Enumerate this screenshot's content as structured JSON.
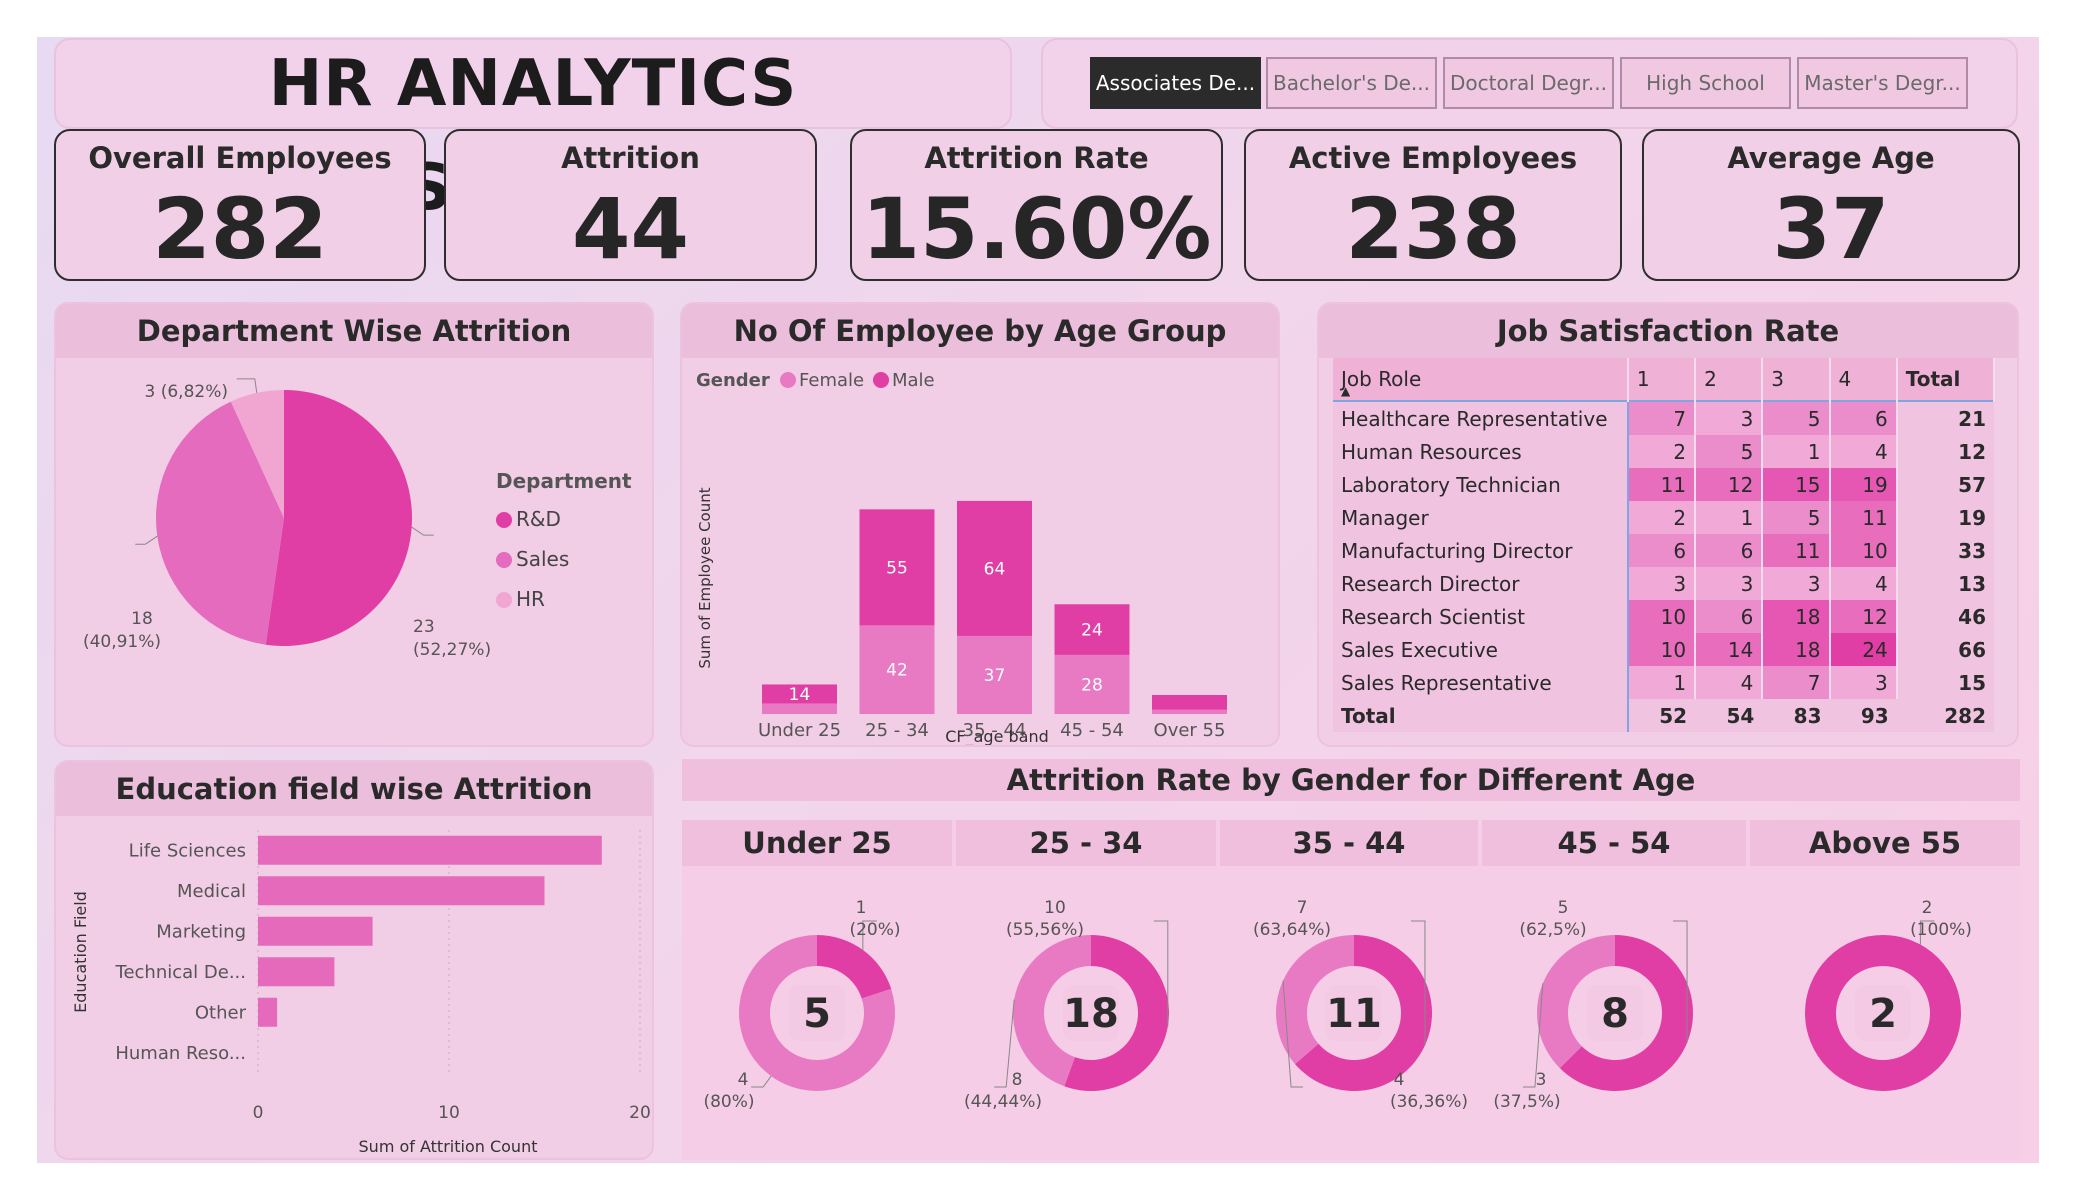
{
  "title": "HR ANALYTICS DASHBOARD",
  "education_slicer": [
    {
      "label": "Associates De...",
      "active": true
    },
    {
      "label": "Bachelor's De...",
      "active": false
    },
    {
      "label": "Doctoral Degr...",
      "active": false
    },
    {
      "label": "High School",
      "active": false
    },
    {
      "label": "Master's Degr...",
      "active": false
    }
  ],
  "kpis": [
    {
      "label": "Overall Employees",
      "value": "282"
    },
    {
      "label": "Attrition",
      "value": "44"
    },
    {
      "label": "Attrition Rate",
      "value": "15.60%"
    },
    {
      "label": "Active Employees",
      "value": "238"
    },
    {
      "label": "Average Age",
      "value": "37"
    }
  ],
  "colors": {
    "rd": "#e03ea4",
    "sales": "#e46bbd",
    "hr": "#f1a6d2",
    "male": "#e03ea4",
    "female": "#e87ac4",
    "bar": "#e66abb"
  },
  "chart_data": [
    {
      "type": "pie",
      "title": "Department Wise Attrition",
      "legend_title": "Department",
      "labels": [
        "R&D",
        "Sales",
        "HR"
      ],
      "values": [
        23,
        18,
        3
      ],
      "data_labels": [
        "23\n(52,27%)",
        "18\n(40,91%)",
        "3 (6,82%)"
      ],
      "legend_position": "right"
    },
    {
      "type": "bar",
      "stacked": true,
      "title": "No Of Employee by Age Group",
      "legend_title": "Gender",
      "categories": [
        "Under 25",
        "25 - 34",
        "35 - 44",
        "45 - 54",
        "Over 55"
      ],
      "series": [
        {
          "name": "Female",
          "values": [
            5,
            42,
            37,
            28,
            2
          ],
          "labels": [
            "",
            "42",
            "37",
            "28",
            ""
          ]
        },
        {
          "name": "Male",
          "values": [
            9,
            55,
            64,
            24,
            7
          ],
          "labels": [
            "14",
            "55",
            "64",
            "24",
            ""
          ]
        }
      ],
      "xlabel": "CF_age band",
      "ylabel": "Sum of Employee Count",
      "legend_position": "top-left"
    },
    {
      "type": "table",
      "title": "Job Satisfaction Rate",
      "columns": [
        "Job Role",
        "1",
        "2",
        "3",
        "4",
        "Total"
      ],
      "rows": [
        [
          "Healthcare Representative",
          7,
          3,
          5,
          6,
          21
        ],
        [
          "Human Resources",
          2,
          5,
          1,
          4,
          12
        ],
        [
          "Laboratory Technician",
          11,
          12,
          15,
          19,
          57
        ],
        [
          "Manager",
          2,
          1,
          5,
          11,
          19
        ],
        [
          "Manufacturing Director",
          6,
          6,
          11,
          10,
          33
        ],
        [
          "Research Director",
          3,
          3,
          3,
          4,
          13
        ],
        [
          "Research Scientist",
          10,
          6,
          18,
          12,
          46
        ],
        [
          "Sales Executive",
          10,
          14,
          18,
          24,
          66
        ],
        [
          "Sales Representative",
          1,
          4,
          7,
          3,
          15
        ]
      ],
      "total_row": [
        "Total",
        52,
        54,
        83,
        93,
        282
      ]
    },
    {
      "type": "bar",
      "orientation": "horizontal",
      "title": "Education field wise Attrition",
      "categories": [
        "Life Sciences",
        "Medical",
        "Marketing",
        "Technical De...",
        "Other",
        "Human Reso..."
      ],
      "values": [
        18,
        15,
        6,
        4,
        1,
        0
      ],
      "xlabel": "Sum of Attrition Count",
      "ylabel": "Education Field",
      "xlim": [
        0,
        20
      ],
      "xticks": [
        "0",
        "10",
        "20"
      ]
    },
    {
      "type": "pie",
      "variant": "donut",
      "title": "Attrition Rate by Gender for Different Age",
      "groups": [
        {
          "name": "Under 25",
          "center": "5",
          "male": 1,
          "female": 4,
          "male_label": [
            "1",
            "(20%)"
          ],
          "female_label": [
            "4",
            "(80%)"
          ]
        },
        {
          "name": "25 - 34",
          "center": "18",
          "male": 10,
          "female": 8,
          "male_label": [
            "10",
            "(55,56%)"
          ],
          "female_label": [
            "8",
            "(44,44%)"
          ]
        },
        {
          "name": "35 - 44",
          "center": "11",
          "male": 7,
          "female": 4,
          "male_label": [
            "7",
            "(63,64%)"
          ],
          "female_label": [
            "4",
            "(36,36%)"
          ]
        },
        {
          "name": "45 - 54",
          "center": "8",
          "male": 5,
          "female": 3,
          "male_label": [
            "5",
            "(62,5%)"
          ],
          "female_label": [
            "3",
            "(37,5%)"
          ]
        },
        {
          "name": "Above 55",
          "center": "2",
          "male": 2,
          "female": 0,
          "male_label": [
            "2",
            "(100%)"
          ],
          "female_label": [
            "",
            ""
          ]
        }
      ]
    }
  ]
}
